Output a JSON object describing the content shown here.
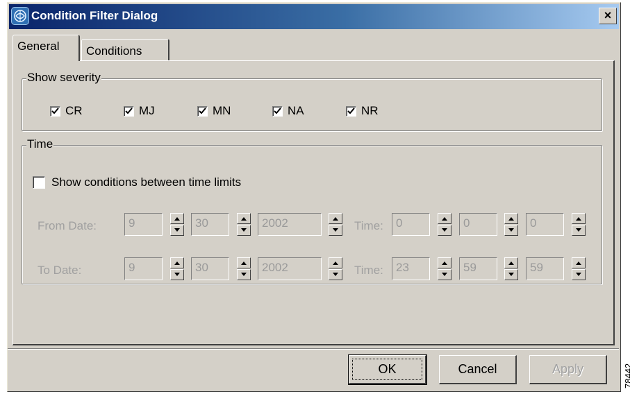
{
  "window": {
    "title": "Condition Filter Dialog",
    "close_label": "×"
  },
  "tabs": [
    {
      "label": "General",
      "active": true
    },
    {
      "label": "Conditions",
      "active": false
    }
  ],
  "severity": {
    "group_label": "Show severity",
    "items": [
      {
        "label": "CR",
        "checked": true
      },
      {
        "label": "MJ",
        "checked": true
      },
      {
        "label": "MN",
        "checked": true
      },
      {
        "label": "NA",
        "checked": true
      },
      {
        "label": "NR",
        "checked": true
      }
    ]
  },
  "time": {
    "group_label": "Time",
    "limit_checkbox_label": "Show conditions between time limits",
    "limit_checked": false,
    "from": {
      "label": "From Date:",
      "month": "9",
      "day": "30",
      "year": "2002",
      "time_label": "Time:",
      "hour": "0",
      "minute": "0",
      "second": "0"
    },
    "to": {
      "label": "To Date:",
      "month": "9",
      "day": "30",
      "year": "2002",
      "time_label": "Time:",
      "hour": "23",
      "minute": "59",
      "second": "59"
    }
  },
  "buttons": {
    "ok": "OK",
    "cancel": "Cancel",
    "apply": "Apply"
  },
  "figure_id": "78442",
  "colors": {
    "titlebar_start": "#0a246a",
    "titlebar_end": "#a6caf0",
    "face": "#d4d0c8",
    "disabled_text": "#a0a0a0"
  }
}
